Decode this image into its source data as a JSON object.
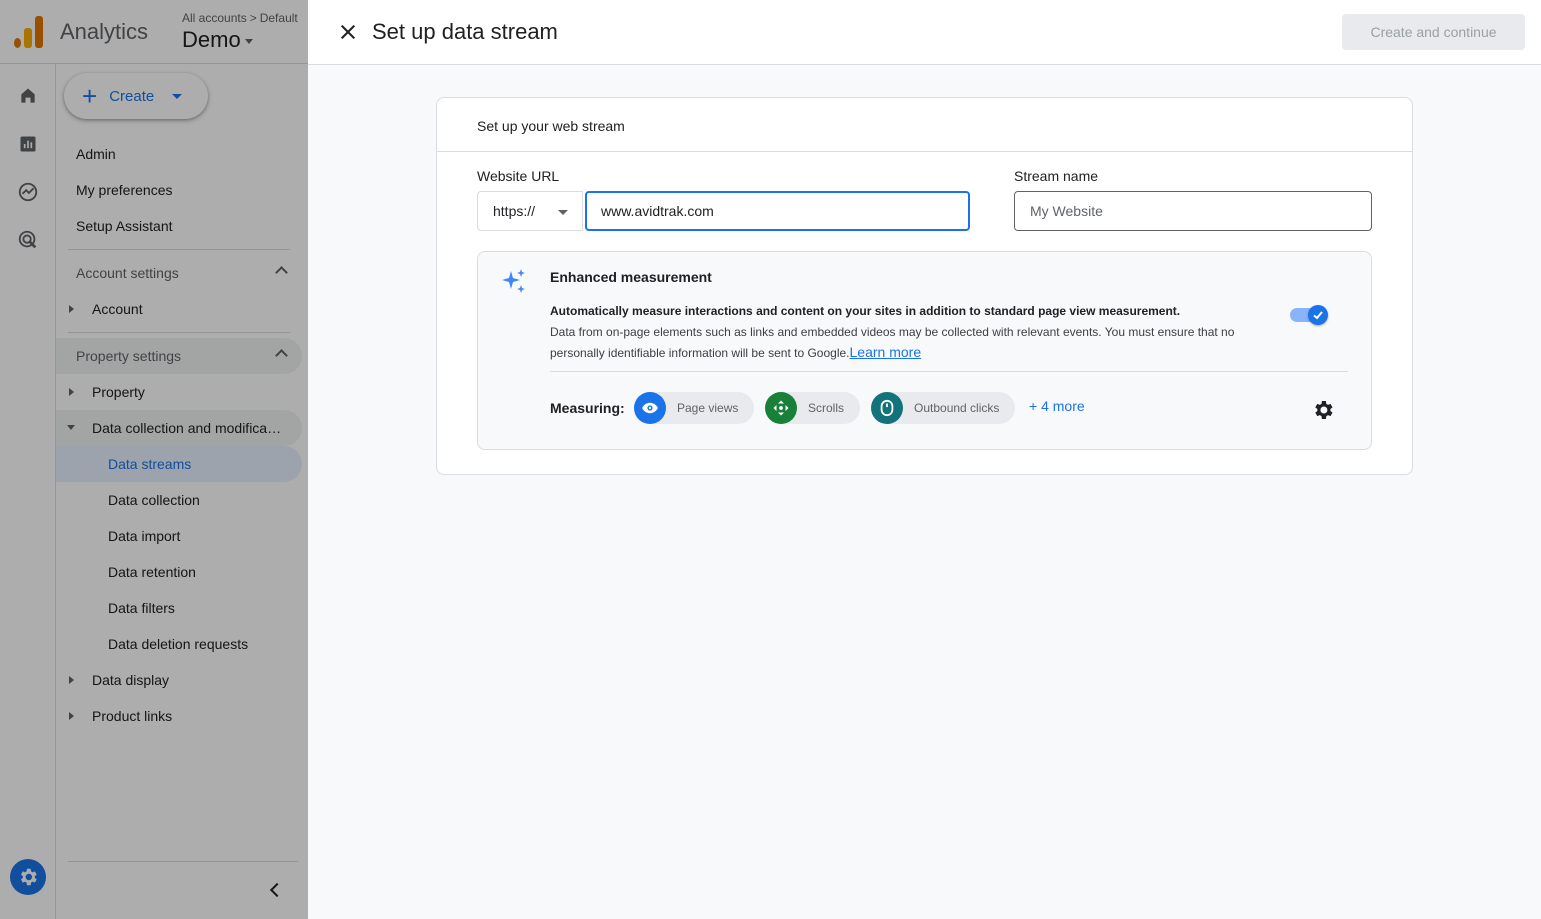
{
  "app": {
    "title": "Analytics",
    "breadcrumb": [
      "All accounts",
      "Default"
    ],
    "breadcrumb_sep": ">",
    "property": "Demo"
  },
  "sidebar": {
    "create_label": "Create",
    "top_items": [
      "Admin",
      "My preferences",
      "Setup Assistant"
    ],
    "account_settings": "Account settings",
    "account": "Account",
    "property_settings": "Property settings",
    "property": "Property",
    "data_collection_mod": "Data collection and modifica…",
    "sub_items": [
      "Data streams",
      "Data collection",
      "Data import",
      "Data retention",
      "Data filters",
      "Data deletion requests"
    ],
    "data_display": "Data display",
    "product_links": "Product links"
  },
  "panel": {
    "title": "Set up data stream",
    "cta": "Create and continue",
    "card_title": "Set up your web stream",
    "website_url_label": "Website URL",
    "protocol": "https://",
    "url_value": "www.avidtrak.com",
    "stream_name_label": "Stream name",
    "stream_name_placeholder": "My Website",
    "enhanced": {
      "title": "Enhanced measurement",
      "lead": "Automatically measure interactions and content on your sites in addition to standard page view measurement.",
      "desc": "Data from on-page elements such as links and embedded videos may be collected with relevant events. You must ensure that no personally identifiable information will be sent to Google.",
      "learn_more": "Learn more",
      "enabled": true,
      "measuring_label": "Measuring:",
      "chips": [
        "Page views",
        "Scrolls",
        "Outbound clicks"
      ],
      "more": "+ 4 more"
    }
  },
  "colors": {
    "accent": "#1a73e8",
    "chip_blue": "#1a73e8",
    "chip_green": "#188038",
    "chip_teal": "#12737a"
  }
}
